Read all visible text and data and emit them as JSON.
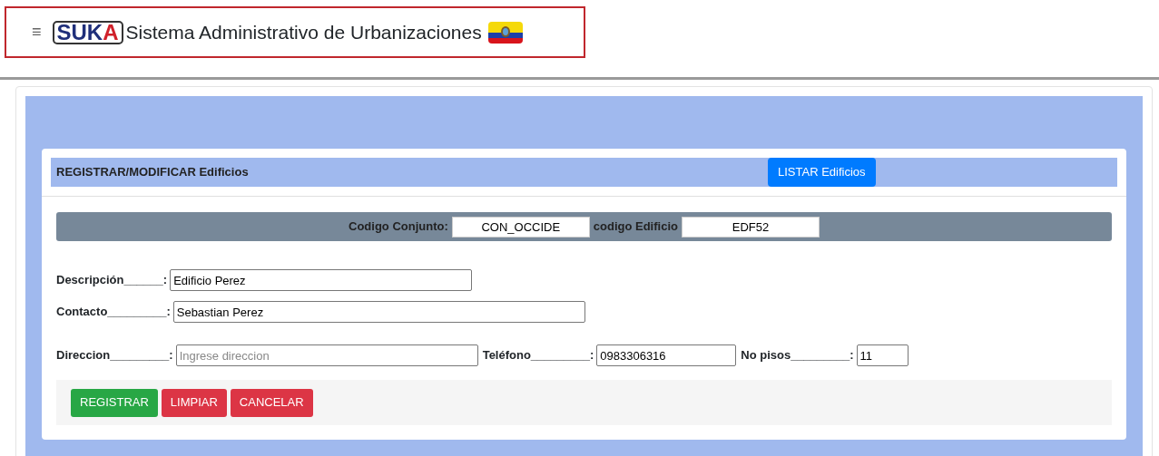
{
  "header": {
    "menu_icon": "≡",
    "logo": [
      {
        "text": "SUK",
        "color": "#1f2f7a"
      },
      {
        "text": "A",
        "color": "#d0202a"
      }
    ],
    "title": "Sistema Administrativo de Urbanizaciones"
  },
  "form": {
    "title": "REGISTRAR/MODIFICAR Edificios",
    "list_button": "LISTAR Edificios",
    "codes": [
      {
        "label": "Codigo Conjunto:",
        "value": "CON_OCCIDE"
      },
      {
        "label": "codigo Edificio",
        "value": "EDF52"
      }
    ],
    "rows": [
      [
        {
          "label": "Descripción______:",
          "value": "Edificio Perez"
        }
      ],
      [
        {
          "label": "Contacto_________:",
          "value": "Sebastian Perez"
        }
      ],
      [
        {
          "label": "Direccion_________:",
          "placeholder": "Ingrese direccion"
        },
        {
          "label": "Teléfono_________:",
          "value": "0983306316"
        },
        {
          "label": "No pisos_________:",
          "value": "11"
        }
      ]
    ],
    "buttons": [
      {
        "label": "REGISTRAR",
        "kind": "primary"
      },
      {
        "label": "LIMPIAR",
        "kind": "danger"
      },
      {
        "label": "CANCELAR",
        "kind": "danger"
      }
    ]
  }
}
